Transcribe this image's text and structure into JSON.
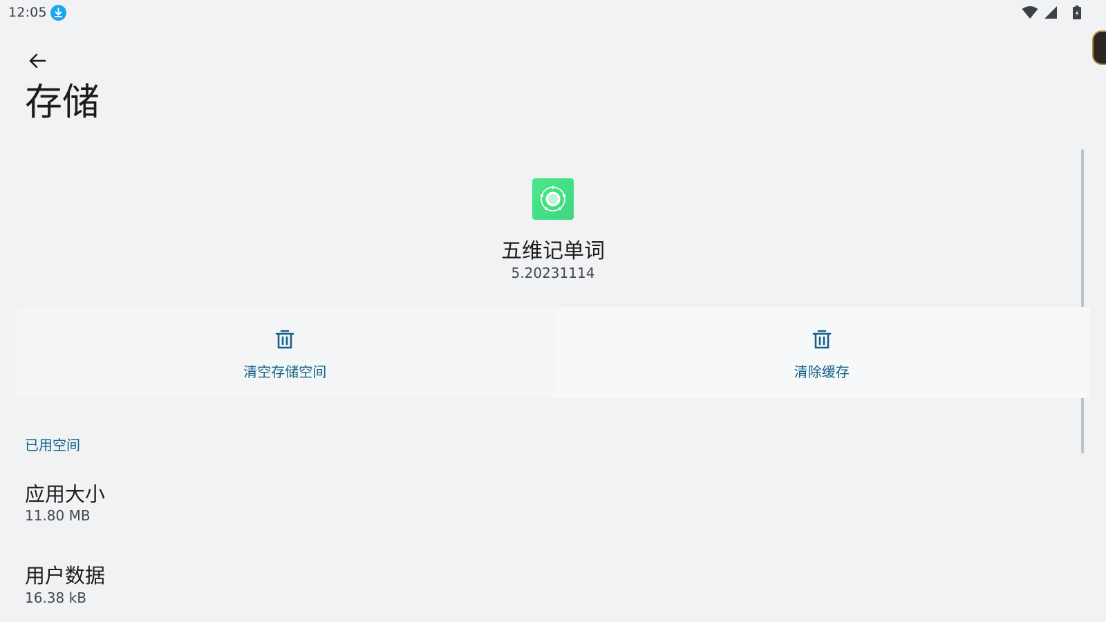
{
  "status_bar": {
    "time": "12:05"
  },
  "header": {
    "title": "存储"
  },
  "app": {
    "name": "五维记单词",
    "version": "5.20231114",
    "icon_color": "#45e085"
  },
  "actions": [
    {
      "label": "清空存储空间"
    },
    {
      "label": "清除缓存"
    }
  ],
  "section": {
    "title": "已用空间",
    "items": [
      {
        "title": "应用大小",
        "value": "11.80 MB"
      },
      {
        "title": "用户数据",
        "value": "16.38 kB"
      }
    ]
  },
  "colors": {
    "accent": "#12628a",
    "background": "#f0f2f4"
  }
}
